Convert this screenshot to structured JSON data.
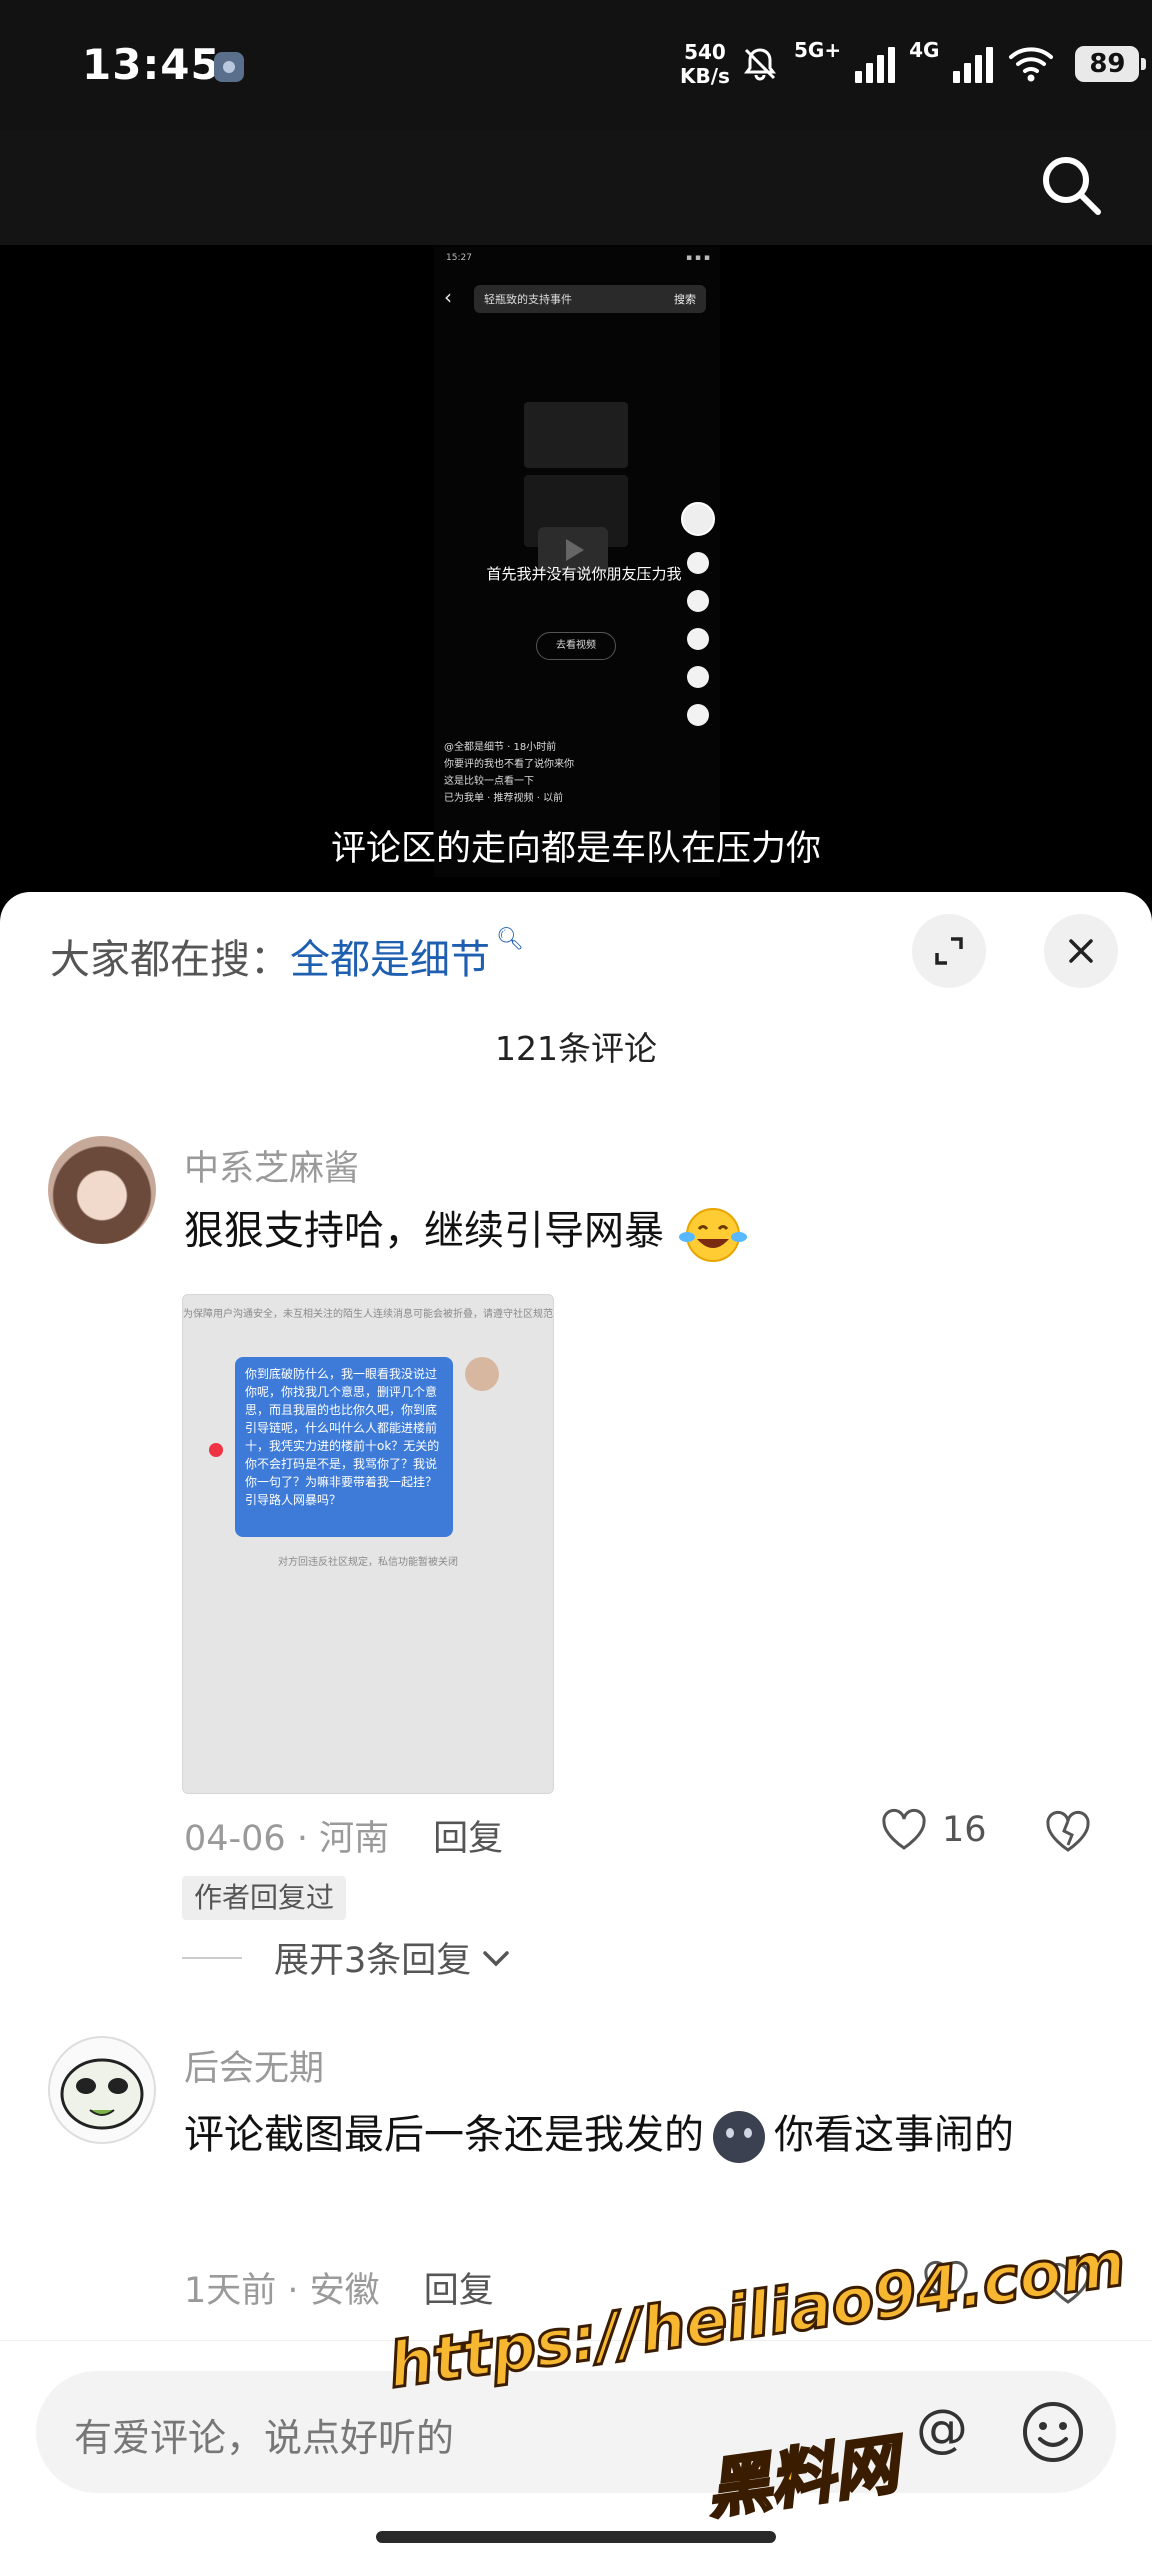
{
  "status_bar": {
    "time": "13:45",
    "speed_value": "540",
    "speed_unit": "KB/s",
    "net1": "5G+",
    "net2": "4G",
    "battery": "89"
  },
  "video": {
    "subtitle": "评论区的走向都是车队在压力你",
    "embedded": {
      "time": "15:27",
      "search_text": "轻瓶致的支持事件",
      "search_btn": "搜索",
      "overlay_text": "首先我并没有说你朋友压力我",
      "button_text": "去看视频",
      "caption_user": "@全都是细节 · 18小时前",
      "caption_line1": "你要评的我也不看了说你来你",
      "caption_line2": "这是比较一点看一下",
      "caption_line3": "已为我单 · 推荐视频 · 以前"
    }
  },
  "sheet": {
    "hot_label": "大家都在搜：",
    "hot_term": "全都是细节",
    "comment_count": "121条评论"
  },
  "comments": [
    {
      "username": "中系芝麻酱",
      "text": "狠狠支持哈，继续引导网暴",
      "date": "04-06",
      "location": "河南",
      "reply_label": "回复",
      "likes": "16",
      "author_tag": "作者回复过",
      "expand_label": "展开3条回复",
      "screenshot": {
        "top_notice": "为保障用户沟通安全，未互相关注的陌生人连续消息可能会被折叠，请遵守社区规范",
        "bubble_text": "你到底破防什么，我一眼看我没说过你呢，你找我几个意思，删评几个意思，而且我届的也比你久吧，你到底引导链呢，什么叫什么人都能进楼前十，我凭实力进的楼前十ok？无关的你不会打码是不是，我骂你了？我说你一句了？为嘛非要带着我一起挂？引导路人网暴吗？",
        "bottom_notice": "对方回违反社区规定，私信功能暂被关闭"
      }
    },
    {
      "username": "后会无期",
      "text_part1": "评论截图最后一条还是我发的",
      "text_part2": "你看这事闹的",
      "date": "1天前",
      "location": "安徽",
      "reply_label": "回复"
    }
  ],
  "input": {
    "placeholder": "有爱评论，说点好听的",
    "at_symbol": "@"
  },
  "watermark": {
    "url": "https://heiliao94.com",
    "name": "黑料网"
  },
  "colors": {
    "hot_term": "#1f5fb0",
    "bubble": "#3e7bd8",
    "watermark": "#f7b730"
  }
}
